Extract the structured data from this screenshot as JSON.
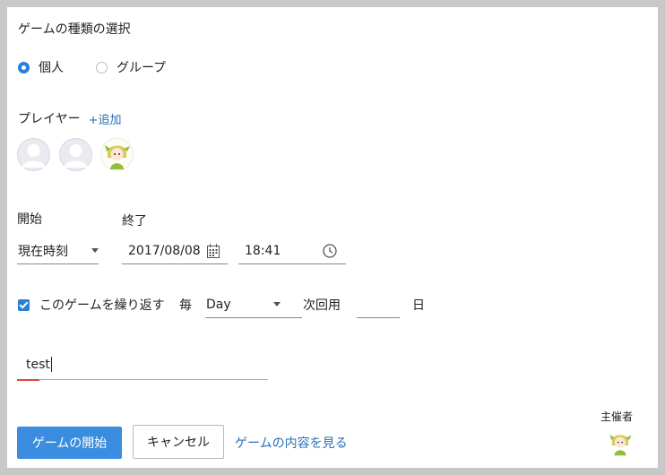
{
  "heading": "ゲームの種類の選択",
  "game_type": {
    "options": [
      "個人",
      "グループ"
    ],
    "selected": "個人"
  },
  "players": {
    "label": "プレイヤー",
    "add_label": "+追加"
  },
  "start": {
    "label": "開始",
    "value": "現在時刻"
  },
  "end": {
    "label": "終了",
    "date": "2017/08/08",
    "time": "18:41"
  },
  "repeat": {
    "label": "このゲームを繰り返す",
    "every_label": "毎",
    "unit_value": "Day",
    "next_label": "次回用",
    "count_value": "",
    "day_label": "日"
  },
  "name_input": {
    "value": "test"
  },
  "actions": {
    "start_button": "ゲームの開始",
    "cancel_button": "キャンセル",
    "view_link": "ゲームの内容を見る"
  },
  "host": {
    "label": "主催者"
  },
  "colors": {
    "accent": "#3b8ddf",
    "link": "#2a6fb7",
    "input_focus": "#7cb4e3",
    "input_error": "#e0463a"
  }
}
